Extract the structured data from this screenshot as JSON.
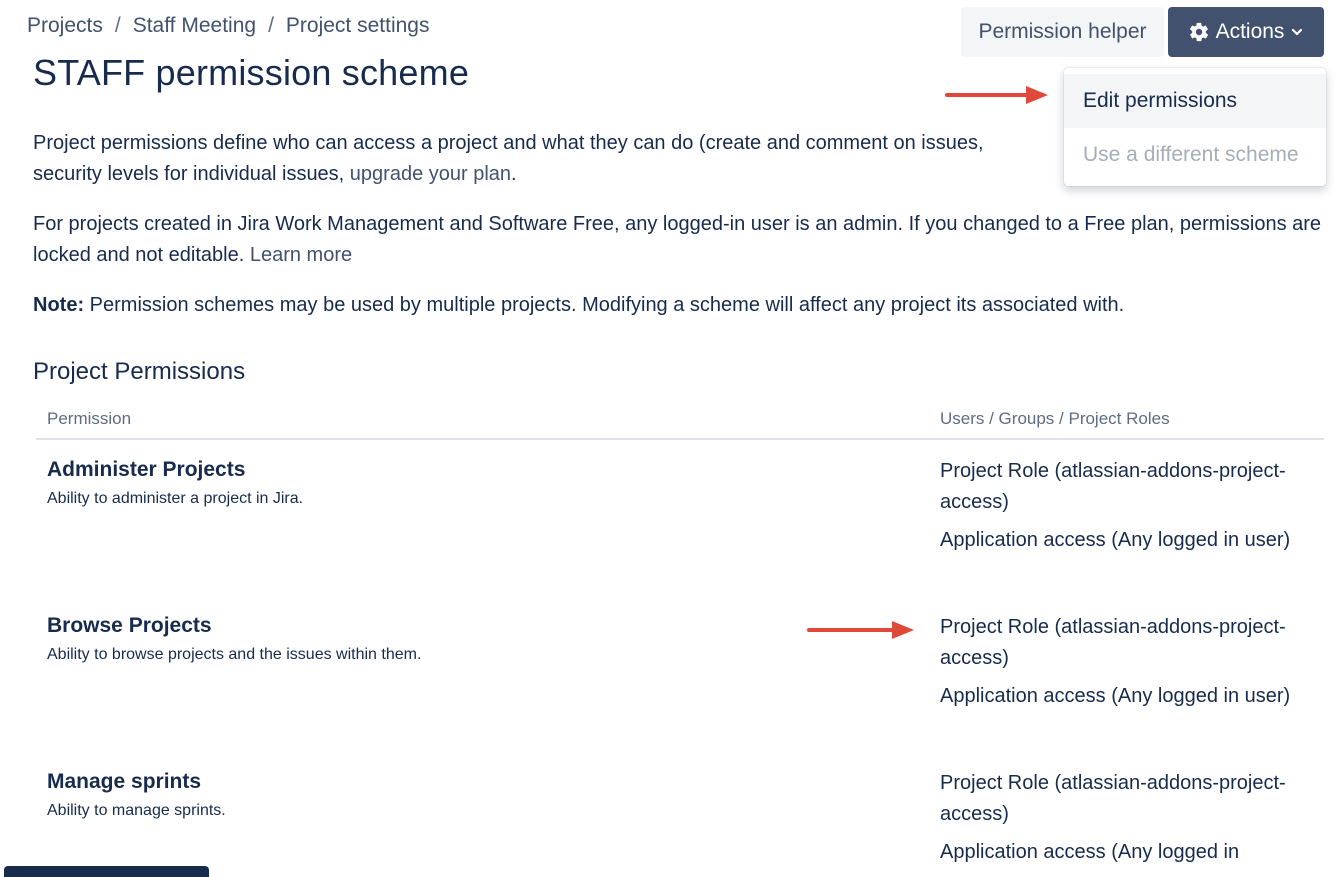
{
  "breadcrumb": {
    "items": [
      "Projects",
      "Staff Meeting",
      "Project settings"
    ],
    "separator": "/"
  },
  "page_title": "STAFF permission scheme",
  "buttons": {
    "permission_helper": "Permission helper",
    "actions": "Actions"
  },
  "actions_menu": {
    "items": [
      "Edit permissions",
      "Use a different scheme"
    ]
  },
  "intro": {
    "p1_text": "Project permissions define who can access a project and what they can do (create and comment on issues, security levels for individual issues, ",
    "p1_link": "upgrade your plan",
    "p1_end": ".",
    "p2_text": "For projects created in Jira Work Management and Software Free, any logged-in user is an admin. If you changed to a Free plan, permissions are locked and not editable. ",
    "p2_link": "Learn more",
    "note_label": "Note:",
    "note_text": " Permission schemes may be used by multiple projects. Modifying a scheme will affect any project its associated with."
  },
  "table": {
    "section_title": "Project Permissions",
    "headers": [
      "Permission",
      "Users / Groups / Project Roles"
    ],
    "rows": [
      {
        "name": "Administer Projects",
        "description": "Ability to administer a project in Jira.",
        "grants": [
          "Project Role (atlassian-addons-project-access)",
          "Application access (Any logged in user)"
        ]
      },
      {
        "name": "Browse Projects",
        "description": "Ability to browse projects and the issues within them.",
        "grants": [
          "Project Role (atlassian-addons-project-access)",
          "Application access (Any logged in user)"
        ]
      },
      {
        "name": "Manage sprints",
        "description": "Ability to manage sprints.",
        "grants": [
          "Project Role (atlassian-addons-project-access)",
          "Application access (Any logged in"
        ]
      }
    ]
  },
  "icons": {
    "actions_icon": "gear-icon",
    "actions_caret": "chevron-down-icon",
    "annotation": "red-arrow-icon"
  },
  "colors": {
    "primary_text": "#172b4d",
    "secondary_text": "#42526e",
    "muted_text": "#5e6c84",
    "actions_bg": "#42526e",
    "helper_bg": "#f4f5f7",
    "disabled_text": "#a5adba",
    "annotation_red": "#e0483a"
  }
}
